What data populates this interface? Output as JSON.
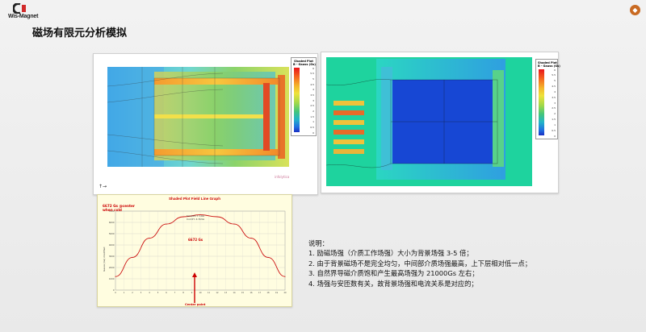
{
  "brand": {
    "name": "Wis-Magnet",
    "accent": "#d12a2a",
    "icon": "wis-magnet-logo"
  },
  "corner_icon": {
    "glyph": "◆",
    "color": "#c96a22"
  },
  "title": "磁场有限元分析模拟",
  "left_sim": {
    "legend_title": "Shaded Plot\nB - Gauss (Gs)",
    "scale": [
      "6",
      "5.5",
      "5",
      "4.5",
      "4",
      "3.5",
      "3",
      "2.5",
      "2",
      "1.5",
      "1",
      "0.5",
      "0"
    ],
    "watermark": "infolytica",
    "axis_icon": "axis-triad"
  },
  "right_sim": {
    "legend_title": "Shaded Plot\nB - Gauss (Gs)",
    "scale": [
      "6",
      "5.5",
      "5",
      "4.5",
      "4",
      "3.5",
      "3",
      "2.5",
      "2",
      "1.5",
      "1",
      "0.5",
      "0"
    ]
  },
  "graph": {
    "title": "Shaded Plot Field Line Graph",
    "center_label": "6672 Gs @center\nwhen cold",
    "legend": "Smooth  Y: 10A\nCoil  IH: 4.7kVA",
    "peak_label": "6672 Gs",
    "ylabel": "Gauss (Gs) modified",
    "center_point_label": "Center point",
    "xticks": [
      "0",
      "1",
      "2",
      "3",
      "4",
      "5",
      "6",
      "7",
      "8",
      "9",
      "10",
      "11",
      "12",
      "13",
      "14",
      "15",
      "16",
      "17",
      "18",
      "19",
      "20"
    ],
    "yticks": [
      "7000",
      "6000",
      "5000",
      "4000",
      "3000",
      "2000",
      "1000",
      "0"
    ],
    "curve_color": "#cc1111"
  },
  "chart_data": {
    "type": "line",
    "title": "Shaded Plot Field Line Graph",
    "xlabel": "",
    "ylabel": "Gauss (Gs) modified",
    "x": [
      0,
      2,
      4,
      6,
      8,
      10,
      12,
      14,
      16,
      18,
      20
    ],
    "series": [
      {
        "values": [
          1200,
          2900,
          4600,
          5850,
          6500,
          6672,
          6500,
          5850,
          4600,
          2900,
          1200
        ]
      }
    ],
    "ylim": [
      0,
      7000
    ],
    "annotations": [
      "6672 Gs @center when cold",
      "6672 Gs",
      "Center point"
    ],
    "grid": true
  },
  "notes": {
    "heading": "说明：",
    "items": [
      "1. 励磁场强（介质工作场强）大小为背景场强 3-5 倍；",
      "2. 由于背景磁场不是完全均匀，中间部介质场强最高，上下层相对低一点；",
      "3. 自然界导磁介质饱和产生最高场强为  21000Gs 左右；",
      "4. 场强与安匝数有关，故背景场强和电流关系是对应的；"
    ]
  }
}
